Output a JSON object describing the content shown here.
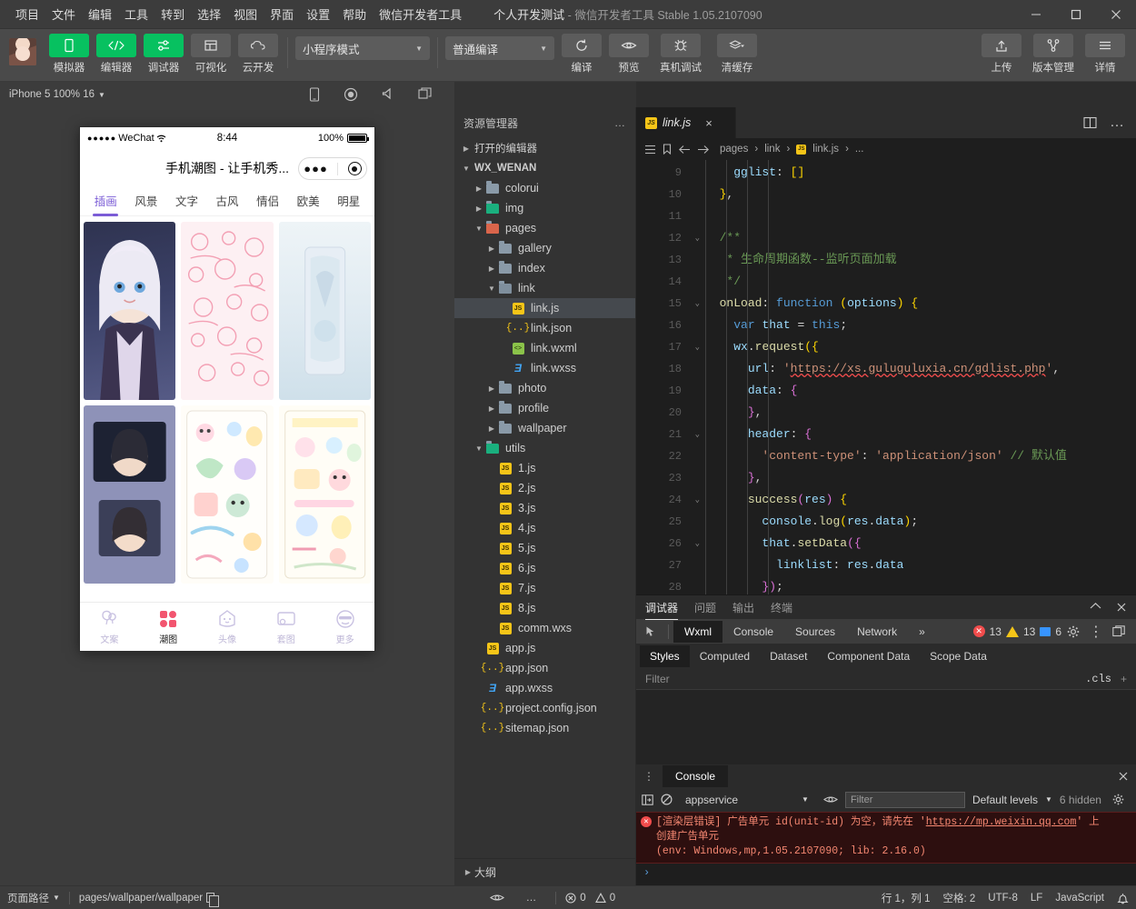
{
  "titlebar": {
    "menus": [
      "项目",
      "文件",
      "编辑",
      "工具",
      "转到",
      "选择",
      "视图",
      "界面",
      "设置",
      "帮助",
      "微信开发者工具"
    ],
    "project_name": "个人开发测试",
    "app_name": "微信开发者工具",
    "version": "Stable 1.05.2107090",
    "window_controls": {
      "minimize": "minimize-icon",
      "maximize": "maximize-icon",
      "close": "close-icon"
    }
  },
  "toolbar": {
    "left_items": [
      {
        "label": "模拟器",
        "icon": "phone-icon",
        "active": true
      },
      {
        "label": "编辑器",
        "icon": "code-icon",
        "active": true
      },
      {
        "label": "调试器",
        "icon": "debug-sliders-icon",
        "active": true
      },
      {
        "label": "可视化",
        "icon": "layout-icon",
        "active": false
      },
      {
        "label": "云开发",
        "icon": "cloud-icon",
        "active": false
      }
    ],
    "mode_select": "小程序模式",
    "compile_select": "普通编译",
    "actions": [
      {
        "label": "编译",
        "icon": "refresh-icon"
      },
      {
        "label": "预览",
        "icon": "eye-icon"
      },
      {
        "label": "真机调试",
        "icon": "bug-icon"
      },
      {
        "label": "清缓存",
        "icon": "layers-icon"
      }
    ],
    "right_items": [
      {
        "label": "上传",
        "icon": "upload-icon"
      },
      {
        "label": "版本管理",
        "icon": "branch-icon"
      },
      {
        "label": "详情",
        "icon": "menu-lines-icon"
      }
    ]
  },
  "simulator_bar": {
    "device": "iPhone 5 100% 16",
    "icons": [
      "device-icon",
      "record-icon",
      "volume-icon",
      "window-icon"
    ]
  },
  "phone": {
    "status": {
      "carrier": "WeChat",
      "dots": "●●●●●",
      "wifi": "wifi-icon",
      "time": "8:44",
      "battery_text": "100%"
    },
    "nav_title": "手机潮图 - 让手机秀...",
    "capsule": {
      "more": "●●●",
      "target": "target-icon"
    },
    "tabs": [
      "插画",
      "风景",
      "文字",
      "古风",
      "情侣",
      "欧美",
      "明星"
    ],
    "active_tab": "插画",
    "tabbar": [
      {
        "label": "文案",
        "icon": "balloon-icon",
        "active": false
      },
      {
        "label": "潮图",
        "icon": "grid-icon",
        "active": true
      },
      {
        "label": "头像",
        "icon": "ghost-icon",
        "active": false
      },
      {
        "label": "套图",
        "icon": "frame-icon",
        "active": false
      },
      {
        "label": "更多",
        "icon": "smiley-icon",
        "active": false
      }
    ]
  },
  "explorer": {
    "title": "资源管理器",
    "more": "…",
    "outline": "大纲",
    "tree": [
      {
        "label": "打开的编辑器",
        "depth": 0,
        "type": "section",
        "arrow": "right",
        "icon": "none"
      },
      {
        "label": "WX_WENAN",
        "depth": 0,
        "type": "root",
        "arrow": "down",
        "icon": "none"
      },
      {
        "label": "colorui",
        "depth": 1,
        "type": "folder",
        "arrow": "right",
        "icon": "folder"
      },
      {
        "label": "img",
        "depth": 1,
        "type": "folder",
        "arrow": "right",
        "icon": "folder-green"
      },
      {
        "label": "pages",
        "depth": 1,
        "type": "folder",
        "arrow": "down",
        "icon": "folder-red"
      },
      {
        "label": "gallery",
        "depth": 2,
        "type": "folder",
        "arrow": "right",
        "icon": "folder"
      },
      {
        "label": "index",
        "depth": 2,
        "type": "folder",
        "arrow": "right",
        "icon": "folder"
      },
      {
        "label": "link",
        "depth": 2,
        "type": "folder",
        "arrow": "down",
        "icon": "folder-open"
      },
      {
        "label": "link.js",
        "depth": 3,
        "type": "file",
        "arrow": "none",
        "icon": "js",
        "selected": true
      },
      {
        "label": "link.json",
        "depth": 3,
        "type": "file",
        "arrow": "none",
        "icon": "json"
      },
      {
        "label": "link.wxml",
        "depth": 3,
        "type": "file",
        "arrow": "none",
        "icon": "wxml"
      },
      {
        "label": "link.wxss",
        "depth": 3,
        "type": "file",
        "arrow": "none",
        "icon": "wxss"
      },
      {
        "label": "photo",
        "depth": 2,
        "type": "folder",
        "arrow": "right",
        "icon": "folder"
      },
      {
        "label": "profile",
        "depth": 2,
        "type": "folder",
        "arrow": "right",
        "icon": "folder"
      },
      {
        "label": "wallpaper",
        "depth": 2,
        "type": "folder",
        "arrow": "right",
        "icon": "folder"
      },
      {
        "label": "utils",
        "depth": 1,
        "type": "folder",
        "arrow": "down",
        "icon": "folder-green"
      },
      {
        "label": "1.js",
        "depth": 2,
        "type": "file",
        "arrow": "none",
        "icon": "js"
      },
      {
        "label": "2.js",
        "depth": 2,
        "type": "file",
        "arrow": "none",
        "icon": "js"
      },
      {
        "label": "3.js",
        "depth": 2,
        "type": "file",
        "arrow": "none",
        "icon": "js"
      },
      {
        "label": "4.js",
        "depth": 2,
        "type": "file",
        "arrow": "none",
        "icon": "js"
      },
      {
        "label": "5.js",
        "depth": 2,
        "type": "file",
        "arrow": "none",
        "icon": "js"
      },
      {
        "label": "6.js",
        "depth": 2,
        "type": "file",
        "arrow": "none",
        "icon": "js"
      },
      {
        "label": "7.js",
        "depth": 2,
        "type": "file",
        "arrow": "none",
        "icon": "js"
      },
      {
        "label": "8.js",
        "depth": 2,
        "type": "file",
        "arrow": "none",
        "icon": "js"
      },
      {
        "label": "comm.wxs",
        "depth": 2,
        "type": "file",
        "arrow": "none",
        "icon": "js"
      },
      {
        "label": "app.js",
        "depth": 1,
        "type": "file",
        "arrow": "none",
        "icon": "js"
      },
      {
        "label": "app.json",
        "depth": 1,
        "type": "file",
        "arrow": "none",
        "icon": "json"
      },
      {
        "label": "app.wxss",
        "depth": 1,
        "type": "file",
        "arrow": "none",
        "icon": "wxss"
      },
      {
        "label": "project.config.json",
        "depth": 1,
        "type": "file",
        "arrow": "none",
        "icon": "json"
      },
      {
        "label": "sitemap.json",
        "depth": 1,
        "type": "file",
        "arrow": "none",
        "icon": "json"
      }
    ]
  },
  "editor": {
    "tab": {
      "label": "link.js",
      "icon": "js-icon",
      "close": "×"
    },
    "tab_actions": [
      "split-editor-icon",
      "more-icon"
    ],
    "breadcrumb": [
      "pages",
      "link",
      "link.js",
      "..."
    ],
    "breadcrumb_icons": [
      "list-icon",
      "bookmark-icon",
      "back-arrow-icon",
      "forward-arrow-icon"
    ],
    "first_line_number": 9,
    "lines": [
      {
        "n": 9,
        "fold": false,
        "html": "    <span class='k-prop'>gglist</span><span class='k-plain'>: </span><span class='k-par'>[]</span>"
      },
      {
        "n": 10,
        "fold": false,
        "html": "  <span class='k-par'>}</span><span class='k-plain'>,</span>"
      },
      {
        "n": 11,
        "fold": false,
        "html": ""
      },
      {
        "n": 12,
        "fold": true,
        "html": "  <span class='k-cmt'>/**</span>"
      },
      {
        "n": 13,
        "fold": false,
        "html": "   <span class='k-cmt'>* 生命周期函数--监听页面加载</span>"
      },
      {
        "n": 14,
        "fold": false,
        "html": "   <span class='k-cmt'>*/</span>"
      },
      {
        "n": 15,
        "fold": true,
        "html": "  <span class='k-fn'>onLoad</span><span class='k-plain'>: </span><span class='k-kw'>function</span> <span class='k-par'>(</span><span class='k-var'>options</span><span class='k-par'>)</span> <span class='k-par'>{</span>"
      },
      {
        "n": 16,
        "fold": false,
        "html": "    <span class='k-kw'>var</span> <span class='k-var'>that</span> <span class='k-plain'>=</span> <span class='k-kw'>this</span><span class='k-plain'>;</span>"
      },
      {
        "n": 17,
        "fold": true,
        "html": "    <span class='k-var'>wx</span><span class='k-plain'>.</span><span class='k-fn'>request</span><span class='k-par'>({</span>"
      },
      {
        "n": 18,
        "fold": false,
        "html": "      <span class='k-prop'>url</span><span class='k-plain'>: </span><span class='k-str'>'</span><span class='k-url'>https://xs.guluguluxia.cn/gdlist.php</span><span class='k-str'>'</span><span class='k-plain'>,</span>"
      },
      {
        "n": 19,
        "fold": false,
        "html": "      <span class='k-prop'>data</span><span class='k-plain'>: </span><span class='k-par2'>{</span>"
      },
      {
        "n": 20,
        "fold": false,
        "html": "      <span class='k-par2'>}</span><span class='k-plain'>,</span>"
      },
      {
        "n": 21,
        "fold": true,
        "html": "      <span class='k-prop'>header</span><span class='k-plain'>: </span><span class='k-par2'>{</span>"
      },
      {
        "n": 22,
        "fold": false,
        "html": "        <span class='k-str'>'content-type'</span><span class='k-plain'>: </span><span class='k-str'>'application/json'</span> <span class='k-cmt'>// 默认值</span>"
      },
      {
        "n": 23,
        "fold": false,
        "html": "      <span class='k-par2'>}</span><span class='k-plain'>,</span>"
      },
      {
        "n": 24,
        "fold": true,
        "html": "      <span class='k-fn'>success</span><span class='k-par2'>(</span><span class='k-var'>res</span><span class='k-par2'>)</span> <span class='k-par'>{</span>"
      },
      {
        "n": 25,
        "fold": false,
        "html": "        <span class='k-var'>console</span><span class='k-plain'>.</span><span class='k-fn'>log</span><span class='k-par'>(</span><span class='k-var'>res</span><span class='k-plain'>.</span><span class='k-var'>data</span><span class='k-par'>)</span><span class='k-plain'>;</span>"
      },
      {
        "n": 26,
        "fold": true,
        "html": "        <span class='k-var'>that</span><span class='k-plain'>.</span><span class='k-fn'>setData</span><span class='k-par2'>({</span>"
      },
      {
        "n": 27,
        "fold": false,
        "html": "          <span class='k-prop'>linklist</span><span class='k-plain'>: </span><span class='k-var'>res</span><span class='k-plain'>.</span><span class='k-var'>data</span>"
      },
      {
        "n": 28,
        "fold": false,
        "html": "        <span class='k-par2'>})</span><span class='k-plain'>;</span>"
      },
      {
        "n": 29,
        "fold": false,
        "html": "      <span class='k-par'>}</span>"
      },
      {
        "n": 30,
        "fold": false,
        "html": "    <span class='k-par'>})</span>"
      }
    ]
  },
  "devtools": {
    "panel_tabs": [
      "调试器",
      "问题",
      "输出",
      "终端"
    ],
    "panel_active": "调试器",
    "panel_controls": [
      "collapse-icon",
      "close-icon"
    ],
    "inspector_tabs": [
      "Wxml",
      "Console",
      "Sources",
      "Network"
    ],
    "inspector_active": "Wxml",
    "overflow": "»",
    "counts": {
      "errors": "13",
      "warnings": "13",
      "infos": "6"
    },
    "right_icons": [
      "gear-icon",
      "kebab-icon",
      "dock-icon"
    ],
    "styles_tabs": [
      "Styles",
      "Computed",
      "Dataset",
      "Component Data",
      "Scope Data"
    ],
    "styles_active": "Styles",
    "filter_placeholder": "Filter",
    "cls_label": ".cls",
    "console": {
      "tab": "Console",
      "context": "appservice",
      "filter_placeholder": "Filter",
      "levels": "Default levels",
      "hidden": "6 hidden",
      "error_line1": "[渲染层错误] 广告单元 id(unit-id) 为空，请先在 ",
      "error_link": "https://mp.weixin.qq.com",
      "error_line1b": " 上",
      "error_line2": "创建广告单元",
      "error_line3": "(env: Windows,mp,1.05.2107090; lib: 2.16.0)",
      "prompt": "›"
    }
  },
  "status_bar": {
    "page_path_label": "页面路径",
    "page_path": "pages/wallpaper/wallpaper",
    "copy_icon": "copy-icon",
    "eye_icon": "eye-icon",
    "more_icon": "more-icon",
    "error_count": "0",
    "warning_count": "0",
    "cursor": "行 1，列 1",
    "spaces": "空格: 2",
    "encoding": "UTF-8",
    "eol": "LF",
    "language": "JavaScript",
    "bell_icon": "bell-icon"
  },
  "colors": {
    "accent_green": "#07c160",
    "error_red": "#f14c4c",
    "warn_yellow": "#f5c518",
    "phone_accent": "#7b5cd6"
  }
}
